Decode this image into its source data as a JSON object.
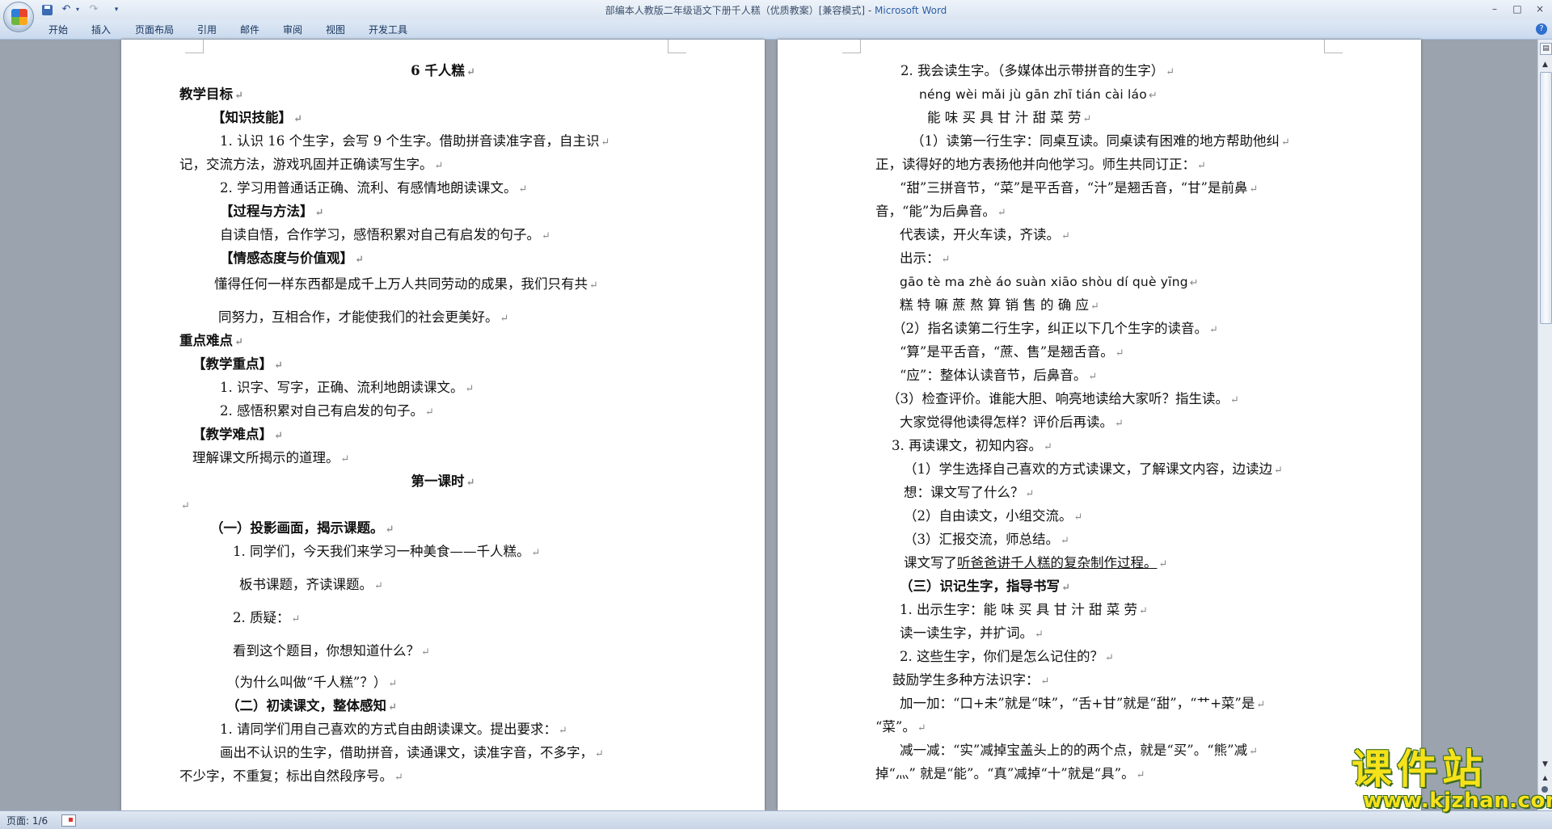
{
  "window": {
    "title_doc": "部编本人教版二年级语文下册千人糕（优质教案）[兼容模式]",
    "title_sep": " - ",
    "title_app": "Microsoft Word"
  },
  "quick_access": {
    "undo_arrow": "▾",
    "customize_arrow": "▾"
  },
  "ribbon": {
    "tabs": [
      "开始",
      "插入",
      "页面布局",
      "引用",
      "邮件",
      "审阅",
      "视图",
      "开发工具"
    ],
    "help": "?"
  },
  "window_controls": {
    "minimize": "–",
    "maximize": "□",
    "close": "×"
  },
  "status": {
    "page": "页面: 1/6"
  },
  "paragraph_mark": "↵",
  "left_page": [
    {
      "text": "6  千人糕",
      "bold": true,
      "center": true
    },
    {
      "text": "教学目标",
      "bold": true
    },
    {
      "text": "【知识技能】",
      "bold": true
    },
    {
      "text": "1.  认识 16 个生字，会写 9 个生字。借助拼音读准字音，自主识"
    },
    {
      "text": "记，交流方法，游戏巩固并正确读写生字。"
    },
    {
      "text": "2. 学习用普通话正确、流利、有感情地朗读课文。"
    },
    {
      "text": "【过程与方法】",
      "bold": true
    },
    {
      "text": "自读自悟，合作学习，感悟积累对自己有启发的句子。"
    },
    {
      "text": "【情感态度与价值观】",
      "bold": true
    },
    {
      "text": "懂得任何一样东西都是成千上万人共同劳动的成果，我们只有共"
    },
    {
      "text": "同努力，互相合作，才能使我们的社会更美好。"
    },
    {
      "text": "重点难点",
      "bold": true
    },
    {
      "text": "【教学重点】",
      "bold": true
    },
    {
      "text": "1. 识字、写字，正确、流利地朗读课文。"
    },
    {
      "text": "2. 感悟积累对自己有启发的句子。"
    },
    {
      "text": "【教学难点】",
      "bold": true
    },
    {
      "text": "理解课文所揭示的道理。"
    },
    {
      "text": "第一课时",
      "bold": true,
      "center": true
    },
    {
      "text": ""
    },
    {
      "text": "（一）投影画面，揭示课题。",
      "bold": true
    },
    {
      "text": "1. 同学们，今天我们来学习一种美食——千人糕。"
    },
    {
      "text": "板书课题，齐读课题。"
    },
    {
      "text": "2.  质疑："
    },
    {
      "text": "看到这个题目，你想知道什么？"
    },
    {
      "text": "（为什么叫做“千人糕”？）"
    },
    {
      "text": "（二）初读课文，整体感知",
      "bold": true
    },
    {
      "text": "1. 请同学们用自己喜欢的方式自由朗读课文。提出要求："
    },
    {
      "text": "画出不认识的生字，借助拼音，读通课文，读准字音，不多字，"
    },
    {
      "text": "不少字，不重复；标出自然段序号。"
    }
  ],
  "right_page": [
    {
      "text": "2. 我会读生字。（多媒体出示带拼音的生字）"
    },
    {
      "text": "néng wèi mǎi jù gān zhī tián cài láo",
      "pinyin": true
    },
    {
      "text": "能   味   买   具 甘   汁   甜    菜   劳"
    },
    {
      "text": "（1）读第一行生字：同桌互读。同桌读有困难的地方帮助他纠"
    },
    {
      "text": "正，读得好的地方表扬他并向他学习。师生共同订正："
    },
    {
      "text": "“甜”三拼音节，“菜”是平舌音，“汁”是翘舌音，“甘”是前鼻"
    },
    {
      "text": "音，“能”为后鼻音。"
    },
    {
      "text": "代表读，开火车读，齐读。"
    },
    {
      "text": "出示："
    },
    {
      "text": "gāo tè ma zhè áo suàn xiāo shòu dí què yīng",
      "pinyin": true
    },
    {
      "text": "糕   特   嘛   蔗   熬   算    销    售    的  确   应"
    },
    {
      "text": "（2）指名读第二行生字，纠正以下几个生字的读音。"
    },
    {
      "text": "“算”是平舌音，“蔗、售”是翘舌音。"
    },
    {
      "text": "“应”：整体认读音节，后鼻音。"
    },
    {
      "text": "（3）检查评价。谁能大胆、响亮地读给大家听？指生读。"
    },
    {
      "text": "大家觉得他读得怎样？评价后再读。"
    },
    {
      "text": "3. 再读课文，初知内容。"
    },
    {
      "text": "（1）学生选择自己喜欢的方式读课文，了解课文内容，边读边"
    },
    {
      "text": "想：课文写了什么？"
    },
    {
      "text": "（2）自由读文，小组交流。"
    },
    {
      "text": "（3）汇报交流，师总结。"
    },
    {
      "text": "课文写了",
      "underline": "听爸爸讲千人糕的复杂制作过程。"
    },
    {
      "text": "（三）识记生字，指导书写",
      "bold": true
    },
    {
      "text": "1. 出示生字：能   味   买   具 甘   汁   甜    菜   劳"
    },
    {
      "text": "读一读生字，并扩词。"
    },
    {
      "text": "2. 这些生字，你们是怎么记住的？"
    },
    {
      "text": "鼓励学生多种方法识字："
    },
    {
      "text": "加一加：“口+未”就是“味”，“舌+甘”就是“甜”，“艹+菜”是"
    },
    {
      "text": "“菜”。"
    },
    {
      "text": "减一减：“实”减掉宝盖头上的的两个点，就是“买”。“熊”减"
    },
    {
      "text": "掉“灬” 就是“能”。“真”减掉“十”就是“具”。"
    }
  ],
  "watermark": {
    "logo": "课件站",
    "url": "www.kjzhan.com"
  }
}
